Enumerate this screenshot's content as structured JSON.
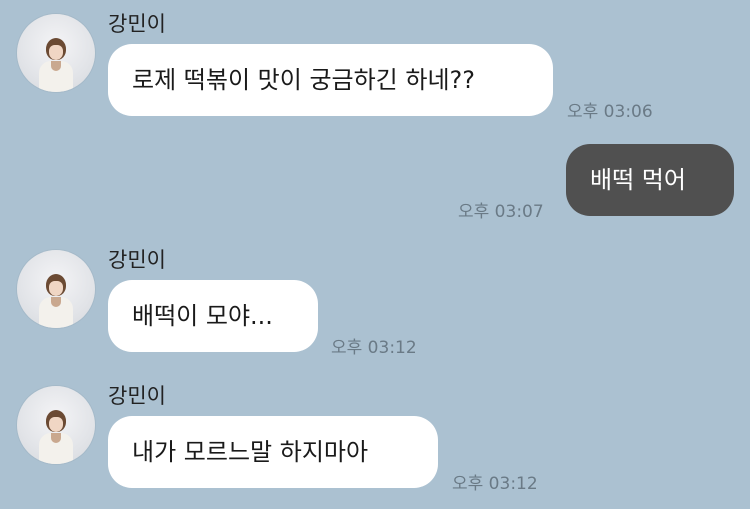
{
  "messages": [
    {
      "sender": "강민이",
      "text": "로제 떡볶이 맛이 궁금하긴 하네??",
      "time": "오후 03:06"
    },
    {
      "text": "배떡 먹어",
      "time": "오후 03:07"
    },
    {
      "sender": "강민이",
      "text": "배떡이 모야...",
      "time": "오후 03:12"
    },
    {
      "sender": "강민이",
      "text": "내가 모르느말 하지마아",
      "time": "오후 03:12"
    }
  ],
  "colors": {
    "background": "#abc1d1",
    "received_bubble": "#ffffff",
    "sent_bubble": "#505050",
    "time_text": "#6a7a86"
  },
  "icons": {
    "avatar": "profile-photo"
  }
}
